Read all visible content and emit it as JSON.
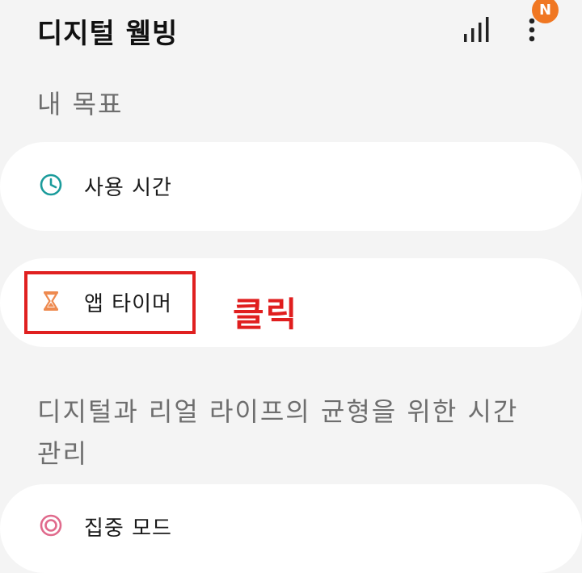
{
  "header": {
    "title": "디지털 웰빙",
    "stats_icon": "bar-chart-icon",
    "more_icon": "more-vertical-icon",
    "badge": "N"
  },
  "goals": {
    "heading": "내 목표",
    "items": [
      {
        "label": "사용 시간",
        "icon": "clock-icon",
        "icon_color": "#1a9b9b"
      },
      {
        "label": "앱 타이머",
        "icon": "hourglass-icon",
        "icon_color": "#ee8a4f"
      }
    ]
  },
  "balance": {
    "heading": "디지털과 리얼 라이프의 균형을 위한 시간 관리",
    "items": [
      {
        "label": "집중 모드",
        "icon": "focus-target-icon",
        "icon_color": "#e06a8c"
      }
    ]
  },
  "annotation": {
    "text": "클릭",
    "color": "#e01e1e"
  }
}
